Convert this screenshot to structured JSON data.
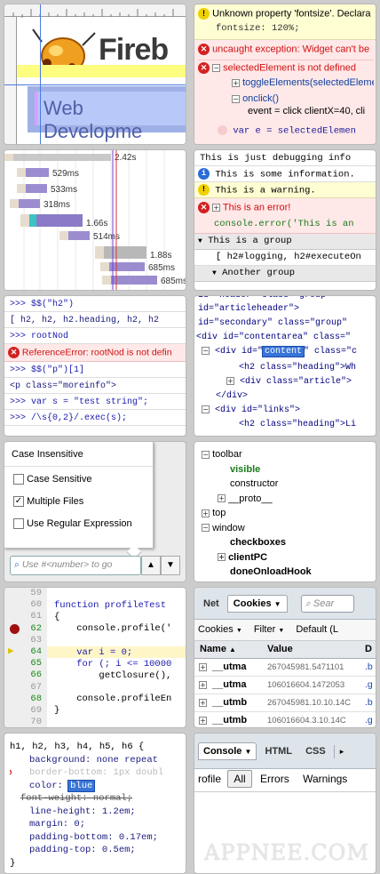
{
  "t1": {
    "logo": "Fireb",
    "banner": "Web Developme"
  },
  "t2": {
    "line1": "Unknown property 'fontsize'. Declara",
    "line2": "fontsize: 120%;",
    "line3": "uncaught exception: Widget can't be",
    "line4": "selectedElement is not defined",
    "line5": "toggleElements(selectedEleme",
    "line6": "onclick()",
    "line7": "event = click clientX=40, cli",
    "line8": "var e = selectedElemen"
  },
  "t3": {
    "labels": [
      "2.42s",
      "529ms",
      "533ms",
      "318ms",
      "1.66s",
      "514ms",
      "1.88s",
      "685ms",
      "685ms"
    ]
  },
  "t4": {
    "l1": "This is just debugging info",
    "l2": "This is some information.",
    "l3": "This is a warning.",
    "l4": "This is an error!",
    "l5": "console.error('This is an",
    "l6": "This is a group",
    "l7": "[ h2#logging, h2#executeOn",
    "l8": "Another group"
  },
  "t5": {
    "l1": ">>> $$(\"h2\")",
    "l2": "[ h2, h2, h2.heading, h2, h2",
    "l3": ">>> rootNod",
    "l4": "ReferenceError: rootNod is not defin",
    "l5": ">>> $$(\"p\")[1]",
    "l6": "<p class=\"moreinfo\">",
    "l7": ">>> var s = \"test string\";",
    "l8": ">>> /\\s{0,2}/.exec(s);"
  },
  "t6": {
    "l0": "id=\"header\" class=\"group\"",
    "l1": "id=\"articleheader\">",
    "l2": "id=\"secondary\" class=\"group\"",
    "l3": "<div id=\"contentarea\" class=\"",
    "l4a": "<div id=\"",
    "l4b": "content",
    "l4c": "\" class=\"c",
    "l5": "<h2 class=\"heading\">Wh",
    "l6": "<div class=\"article\">",
    "l7": "</div>",
    "l8": "<div id=\"links\">",
    "l9": "<h2 class=\"heading\">Li"
  },
  "t7": {
    "title": "Case Insensitive",
    "opts": [
      "Case Sensitive",
      "Multiple Files",
      "Use Regular Expression"
    ],
    "checked": [
      false,
      true,
      false
    ],
    "placeholder": "Use #<number> to go"
  },
  "t8": {
    "items": [
      "toolbar",
      "visible",
      "constructor",
      "__proto__",
      "top",
      "window",
      "checkboxes",
      "clientPC",
      "doneOnloadHook"
    ]
  },
  "t9": {
    "lines": [
      [
        "59",
        ""
      ],
      [
        "60",
        "function profileTest"
      ],
      [
        "61",
        "{"
      ],
      [
        "62",
        "    console.profile('"
      ],
      [
        "63",
        ""
      ],
      [
        "64",
        "    var i = 0;"
      ],
      [
        "65",
        "    for (; i <= 10000"
      ],
      [
        "66",
        "        getClosure(),"
      ],
      [
        "67",
        ""
      ],
      [
        "68",
        "    console.profileEn"
      ],
      [
        "69",
        "}"
      ],
      [
        "70",
        ""
      ]
    ]
  },
  "t10": {
    "tabs": [
      "Net",
      "Cookies"
    ],
    "search": "Sear",
    "filters": [
      "Cookies",
      "Filter",
      "Default (L"
    ],
    "cols": [
      "Name",
      "Value",
      "D"
    ],
    "rows": [
      [
        "__utma",
        "267045981.5471101",
        ".b"
      ],
      [
        "__utma",
        "106016604.1472053",
        ".g"
      ],
      [
        "__utmb",
        "267045981.10.10.14C",
        ".b"
      ],
      [
        "__utmb",
        "106016604.3.10.14C",
        ".g"
      ]
    ]
  },
  "t11": {
    "lines": [
      "h1, h2, h3, h4, h5, h6 {",
      "background: none repeat",
      "border-bottom: 1px doubl",
      "color:",
      "blue",
      "font-weight: normal;",
      "line-height: 1.2em;",
      "margin: 0;",
      "padding-bottom: 0.17em;",
      "padding-top: 0.5em;",
      "}"
    ]
  },
  "t12": {
    "tabs": [
      "Console",
      "HTML",
      "CSS"
    ],
    "filters": [
      "rofile",
      "All",
      "Errors",
      "Warnings"
    ],
    "watermark": "APPNEE.COM"
  }
}
